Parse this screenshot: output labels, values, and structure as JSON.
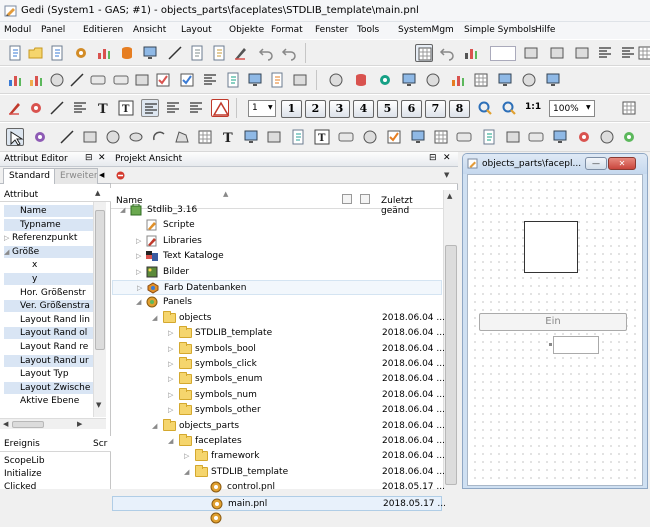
{
  "window": {
    "title": "Gedi (System1 - GAS; #1) - objects_parts\\faceplates\\STDLIB_template\\main.pnl"
  },
  "menu": [
    "Modul",
    "Panel",
    "Editieren",
    "Ansicht",
    "Layout",
    "Objekte",
    "Format",
    "Fenster",
    "Tools",
    "SystemMgm",
    "Simple Symbols",
    "Hilfe"
  ],
  "toolbar": {
    "zoom_value": "100%",
    "scale_label": "1:1",
    "layer_buttons": [
      "1",
      "2",
      "3",
      "4",
      "5",
      "6",
      "7",
      "8"
    ],
    "layer_dropdown": "1"
  },
  "attr_editor": {
    "title": "Attribut Editor",
    "close": "✕",
    "pin": "⊟",
    "tabs": [
      "Standard",
      "Erweitert"
    ],
    "header": "Attribut",
    "rows": [
      {
        "label": "Name",
        "indent": 2,
        "sel": true
      },
      {
        "label": "Typname",
        "indent": 2,
        "sel": true
      },
      {
        "label": "Referenzpunkt",
        "indent": 0,
        "tri": "▷",
        "sel": false
      },
      {
        "label": "Größe",
        "indent": 0,
        "tri": "◢",
        "sel": true
      },
      {
        "label": "x",
        "indent": 5,
        "sel": false
      },
      {
        "label": "y",
        "indent": 5,
        "sel": true
      },
      {
        "label": "Hor. Größenstr",
        "indent": 2,
        "sel": false
      },
      {
        "label": "Ver. Größenstra",
        "indent": 2,
        "sel": true
      },
      {
        "label": "Layout Rand lin",
        "indent": 2,
        "sel": false
      },
      {
        "label": "Layout Rand ol",
        "indent": 2,
        "sel": true
      },
      {
        "label": "Layout Rand re",
        "indent": 2,
        "sel": false
      },
      {
        "label": "Layout Rand ur",
        "indent": 2,
        "sel": true
      },
      {
        "label": "Layout Typ",
        "indent": 2,
        "sel": false
      },
      {
        "label": "Layout Zwische",
        "indent": 2,
        "sel": true
      },
      {
        "label": "Aktive Ebene",
        "indent": 2,
        "sel": false
      }
    ],
    "events_header": [
      "Ereignis",
      "Scr"
    ],
    "events": [
      "ScopeLib",
      "Initialize",
      "Clicked"
    ]
  },
  "project": {
    "title": "Projekt Ansicht",
    "close": "✕",
    "pin": "⊟",
    "col_name": "Name",
    "col_changed": "Zuletzt geänd",
    "rows": [
      {
        "label": "Stdlib_3.16",
        "tri": "◢",
        "icon": "project",
        "x": 0,
        "date": ""
      },
      {
        "label": "Scripte",
        "tri": "",
        "icon": "script",
        "x": 1,
        "date": ""
      },
      {
        "label": "Libraries",
        "tri": "▷",
        "icon": "library",
        "x": 1,
        "date": ""
      },
      {
        "label": "Text Kataloge",
        "tri": "▷",
        "icon": "catalog",
        "x": 1,
        "date": ""
      },
      {
        "label": "Bilder",
        "tri": "▷",
        "icon": "images",
        "x": 1,
        "date": ""
      },
      {
        "label": "Farb Datenbanken",
        "tri": "▷",
        "icon": "colors",
        "x": 1,
        "date": "",
        "state": "hov"
      },
      {
        "label": "Panels",
        "tri": "◢",
        "icon": "panels",
        "x": 1,
        "date": ""
      },
      {
        "label": "objects",
        "tri": "◢",
        "icon": "folder",
        "x": 2,
        "date": "2018.06.04 ..."
      },
      {
        "label": "STDLIB_template",
        "tri": "▷",
        "icon": "folder",
        "x": 3,
        "date": "2018.06.04 ..."
      },
      {
        "label": "symbols_bool",
        "tri": "▷",
        "icon": "folder",
        "x": 3,
        "date": "2018.06.04 ..."
      },
      {
        "label": "symbols_click",
        "tri": "▷",
        "icon": "folder",
        "x": 3,
        "date": "2018.06.04 ..."
      },
      {
        "label": "symbols_enum",
        "tri": "▷",
        "icon": "folder",
        "x": 3,
        "date": "2018.06.04 ..."
      },
      {
        "label": "symbols_num",
        "tri": "▷",
        "icon": "folder",
        "x": 3,
        "date": "2018.06.04 ..."
      },
      {
        "label": "symbols_other",
        "tri": "▷",
        "icon": "folder",
        "x": 3,
        "date": "2018.06.04 ..."
      },
      {
        "label": "objects_parts",
        "tri": "◢",
        "icon": "folder",
        "x": 2,
        "date": "2018.06.04 ..."
      },
      {
        "label": "faceplates",
        "tri": "◢",
        "icon": "folder",
        "x": 3,
        "date": "2018.06.04 ..."
      },
      {
        "label": "framework",
        "tri": "▷",
        "icon": "folder",
        "x": 4,
        "date": "2018.06.04 ..."
      },
      {
        "label": "STDLIB_template",
        "tri": "◢",
        "icon": "folder",
        "x": 4,
        "date": "2018.06.04 ..."
      },
      {
        "label": "control.pnl",
        "tri": "",
        "icon": "pnl",
        "x": 5,
        "date": "2018.05.17 ..."
      },
      {
        "label": "main.pnl",
        "tri": "",
        "icon": "pnl",
        "x": 5,
        "date": "2018.05.17 ...",
        "state": "sel"
      },
      {
        "label": "",
        "tri": "",
        "icon": "pnl",
        "x": 5,
        "date": ""
      }
    ]
  },
  "canvas": {
    "title": "objects_parts\\facepl...",
    "button_label": "Ein",
    "min": "—",
    "max": "▭",
    "close": "✕"
  },
  "colors": {
    "accent": "#3b6fb6",
    "close_red": "#c9463d",
    "folder": "#f5d56d"
  }
}
